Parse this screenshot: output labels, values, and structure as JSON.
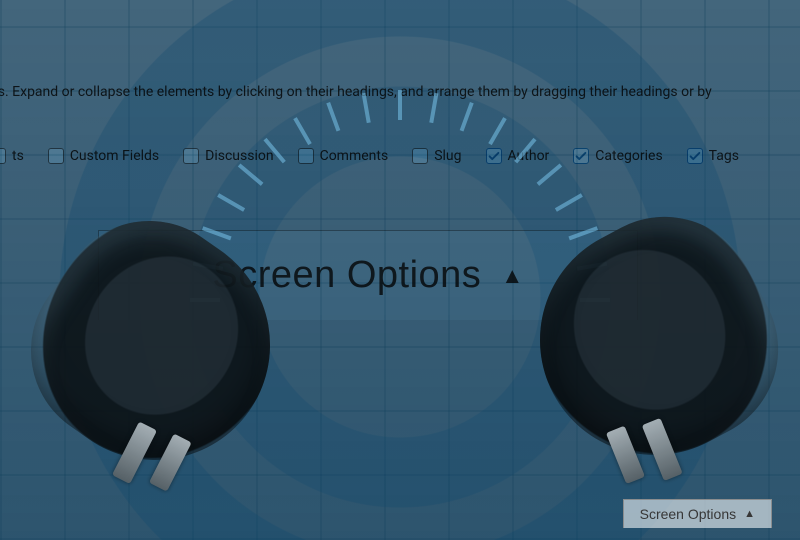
{
  "help_text": "eckboxes. Expand or collapse the elements by clicking on their headings, and arrange them by dragging their headings or by",
  "checkboxes": [
    {
      "label": "ts",
      "checked": false
    },
    {
      "label": "Custom Fields",
      "checked": false
    },
    {
      "label": "Discussion",
      "checked": false
    },
    {
      "label": "Comments",
      "checked": false
    },
    {
      "label": "Slug",
      "checked": false
    },
    {
      "label": "Author",
      "checked": true
    },
    {
      "label": "Categories",
      "checked": true
    },
    {
      "label": "Tags",
      "checked": true
    }
  ],
  "big_toggle": {
    "label": "Screen Options",
    "glyph": "▲"
  },
  "small_toggle": {
    "label": "Screen Options",
    "glyph": "▲"
  }
}
